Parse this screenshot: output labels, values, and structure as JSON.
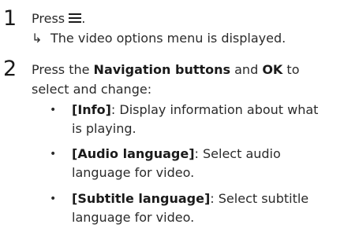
{
  "step1": {
    "number": "1",
    "press": "Press",
    "period": ".",
    "result_arrow": "↳",
    "result": "The video options menu is displayed."
  },
  "step2": {
    "number": "2",
    "intro_prefix": "Press the",
    "nav_buttons": "Navigation buttons",
    "and": "and",
    "ok": "OK",
    "to": "to",
    "intro_line2": "select and change:",
    "bullet_char": "•",
    "items": [
      {
        "term": "[Info]",
        "line1": ": Display information about what",
        "line2": "is playing."
      },
      {
        "term": "[Audio language]",
        "line1": ": Select audio",
        "line2": "language for video."
      },
      {
        "term": "[Subtitle language]",
        "line1": ": Select subtitle",
        "line2": "language for video."
      }
    ]
  }
}
